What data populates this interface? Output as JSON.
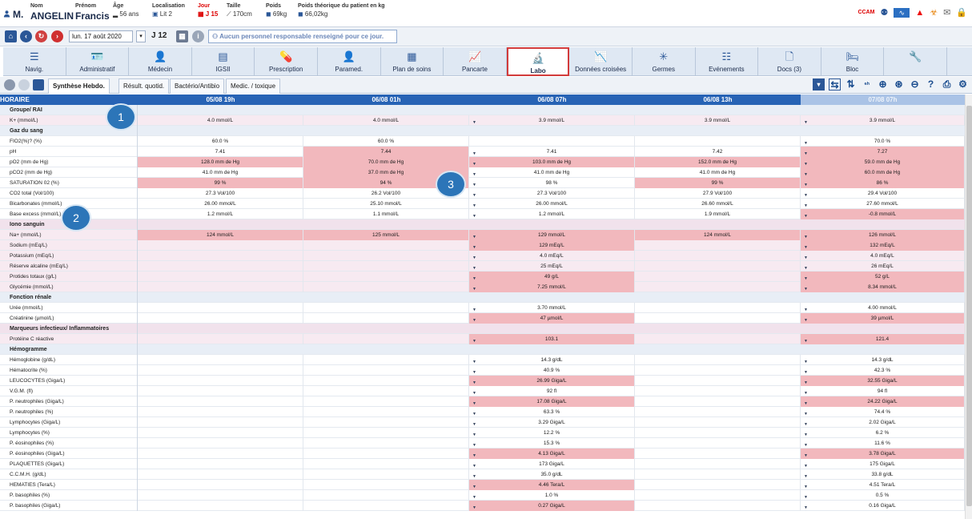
{
  "patient": {
    "nom_label": "Nom",
    "prenom_label": "Prénom",
    "age_label": "Âge",
    "loc_label": "Localisation",
    "jour_label": "Jour",
    "taille_label": "Taille",
    "poids_label": "Poids",
    "poids_theo_label": "Poids théorique du patient en kg",
    "civ": "M.",
    "nom": "ANGELIN",
    "prenom": "Francis",
    "age": "56 ans",
    "lit": "Lit 2",
    "jour": "J 15",
    "taille": "170cm",
    "poids": "69kg",
    "poids_theo": "66,02kg"
  },
  "header_icons": {
    "ccam": "CCAM"
  },
  "toolbar": {
    "date": "lun. 17 août 2020",
    "j": "J 12",
    "message": "Aucun personnel responsable renseigné pour ce jour."
  },
  "modules": [
    {
      "label": "Navig.",
      "icon": "navig-icon"
    },
    {
      "label": "Administratif",
      "icon": "admin-icon"
    },
    {
      "label": "Médecin",
      "icon": "doctor-icon"
    },
    {
      "label": "IGSII",
      "icon": "document-icon"
    },
    {
      "label": "Prescription",
      "icon": "pill-icon"
    },
    {
      "label": "Paramed.",
      "icon": "nurse-icon"
    },
    {
      "label": "Plan de soins",
      "icon": "grid-icon"
    },
    {
      "label": "Pancarte",
      "icon": "chart-icon"
    },
    {
      "label": "Labo",
      "icon": "microscope-icon"
    },
    {
      "label": "Données croisées",
      "icon": "chart2-icon"
    },
    {
      "label": "Germes",
      "icon": "germ-icon"
    },
    {
      "label": "Evénements",
      "icon": "list-icon"
    },
    {
      "label": "Docs (3)",
      "icon": "docs-icon"
    },
    {
      "label": "Bloc",
      "icon": "bed-icon"
    },
    {
      "label": "",
      "icon": "wrench-icon"
    }
  ],
  "tabs": [
    "Synthèse Hebdo.",
    "Résult. quotid.",
    "Bactério/Antibio",
    "Medic. / toxique"
  ],
  "grid": {
    "header": [
      "HORAIRE",
      "05/08 19h",
      "06/08 01h",
      "06/08 07h",
      "06/08 13h",
      "07/08 07h"
    ],
    "rows": [
      {
        "label": "Groupe/ RAI",
        "section": true
      },
      {
        "label": "K+ (mmol/L)",
        "lc": true,
        "v": [
          "4.0 mmol/L",
          "4.0 mmol/L",
          "3.9 mmol/L",
          "3.9 mmol/L",
          "3.9 mmol/L"
        ]
      },
      {
        "label": "Gaz du sang",
        "section": true
      },
      {
        "label": "FIO2(%)? (%)",
        "v": [
          "60.0 %",
          "60.0 %",
          "",
          "",
          "70.0 %"
        ]
      },
      {
        "label": "pH",
        "v": [
          "7.41",
          "7.44",
          "7.41",
          "7.42",
          "7.27"
        ],
        "ab": [
          false,
          true,
          false,
          false,
          true
        ]
      },
      {
        "label": "pO2 (mm de Hg)",
        "v": [
          "128.0 mm de Hg",
          "70.0 mm de Hg",
          "103.0 mm de Hg",
          "152.0 mm de Hg",
          "59.0 mm de Hg"
        ],
        "ab": [
          true,
          true,
          true,
          true,
          true
        ]
      },
      {
        "label": "pCO2 (mm de Hg)",
        "v": [
          "41.0 mm de Hg",
          "37.0 mm de Hg",
          "41.0 mm de Hg",
          "41.0 mm de Hg",
          "60.0 mm de Hg"
        ],
        "ab": [
          false,
          true,
          false,
          false,
          true
        ]
      },
      {
        "label": "SATURATION 02 (%)",
        "v": [
          "99 %",
          "94 %",
          "98 %",
          "99 %",
          "86 %"
        ],
        "ab": [
          true,
          true,
          false,
          true,
          true
        ]
      },
      {
        "label": "CO2 total (Vol/100)",
        "v": [
          "27.3 Vol/100",
          "26.2 Vol/100",
          "27.3 Vol/100",
          "27.9 Vol/100",
          "29.4 Vol/100"
        ]
      },
      {
        "label": "Bicarbonates (mmol/L)",
        "v": [
          "26.00 mmol/L",
          "25.10 mmol/L",
          "26.00 mmol/L",
          "26.60 mmol/L",
          "27.60 mmol/L"
        ]
      },
      {
        "label": "Base excess (mmol/L)",
        "v": [
          "1.2 mmol/L",
          "1.1 mmol/L",
          "1.2 mmol/L",
          "1.9 mmol/L",
          "-0.8 mmol/L"
        ],
        "ab": [
          false,
          false,
          false,
          false,
          true
        ]
      },
      {
        "label": "Iono sanguin",
        "section": true,
        "lc": true
      },
      {
        "label": "Na+ (mmol/L)",
        "lc": true,
        "v": [
          "124 mmol/L",
          "125 mmol/L",
          "129 mmol/L",
          "124 mmol/L",
          "126 mmol/L"
        ],
        "ab": [
          true,
          true,
          true,
          true,
          true
        ]
      },
      {
        "label": "Sodium (mEq/L)",
        "lc": true,
        "v": [
          "",
          "",
          "129 mEq/L",
          "",
          "132 mEq/L"
        ],
        "ab": [
          false,
          false,
          true,
          false,
          true
        ]
      },
      {
        "label": "Potassium (mEq/L)",
        "lc": true,
        "v": [
          "",
          "",
          "4.0 mEq/L",
          "",
          "4.0 mEq/L"
        ]
      },
      {
        "label": "Réserve alcaline (mEq/L)",
        "lc": true,
        "v": [
          "",
          "",
          "25 mEq/L",
          "",
          "26 mEq/L"
        ]
      },
      {
        "label": "Protides totaux (g/L)",
        "lc": true,
        "v": [
          "",
          "",
          "49 g/L",
          "",
          "52 g/L"
        ],
        "ab": [
          false,
          false,
          true,
          false,
          true
        ]
      },
      {
        "label": "Glycémie (mmol/L)",
        "lc": true,
        "v": [
          "",
          "",
          "7.25 mmol/L",
          "",
          "8.34 mmol/L"
        ],
        "ab": [
          false,
          false,
          true,
          false,
          true
        ]
      },
      {
        "label": "Fonction rénale",
        "section": true
      },
      {
        "label": "Urée (mmol/L)",
        "v": [
          "",
          "",
          "3.70 mmol/L",
          "",
          "4.00 mmol/L"
        ]
      },
      {
        "label": "Créatinine (µmol/L)",
        "v": [
          "",
          "",
          "47 µmol/L",
          "",
          "39 µmol/L"
        ],
        "ab": [
          false,
          false,
          true,
          false,
          true
        ]
      },
      {
        "label": "Marqueurs infectieux/ Inflammatoires",
        "section": true,
        "lc": true
      },
      {
        "label": "Protéine C réactive",
        "lc": true,
        "v": [
          "",
          "",
          "103.1",
          "",
          "121.4"
        ],
        "ab": [
          false,
          false,
          true,
          false,
          true
        ]
      },
      {
        "label": "Hémogramme",
        "section": true
      },
      {
        "label": "Hémoglobine (g/dL)",
        "v": [
          "",
          "",
          "14.3 g/dL",
          "",
          "14.3 g/dL"
        ]
      },
      {
        "label": "Hématocrite (%)",
        "v": [
          "",
          "",
          "40.9 %",
          "",
          "42.3 %"
        ]
      },
      {
        "label": "LEUCOCYTES (Giga/L)",
        "v": [
          "",
          "",
          "26.99 Giga/L",
          "",
          "32.55 Giga/L"
        ],
        "ab": [
          false,
          false,
          true,
          false,
          true
        ]
      },
      {
        "label": "V.G.M. (fl)",
        "v": [
          "",
          "",
          "92 fl",
          "",
          "94 fl"
        ]
      },
      {
        "label": "P. neutrophiles (Giga/L)",
        "v": [
          "",
          "",
          "17.08 Giga/L",
          "",
          "24.22 Giga/L"
        ],
        "ab": [
          false,
          false,
          true,
          false,
          true
        ]
      },
      {
        "label": "P. neutrophiles (%)",
        "v": [
          "",
          "",
          "63.3 %",
          "",
          "74.4 %"
        ]
      },
      {
        "label": "Lymphocytes (Giga/L)",
        "v": [
          "",
          "",
          "3.29 Giga/L",
          "",
          "2.02 Giga/L"
        ]
      },
      {
        "label": "Lymphocytes (%)",
        "v": [
          "",
          "",
          "12.2 %",
          "",
          "6.2 %"
        ]
      },
      {
        "label": "P. éosinophiles (%)",
        "v": [
          "",
          "",
          "15.3 %",
          "",
          "11.6 %"
        ]
      },
      {
        "label": "P. éosinophiles (Giga/L)",
        "v": [
          "",
          "",
          "4.13 Giga/L",
          "",
          "3.78 Giga/L"
        ],
        "ab": [
          false,
          false,
          true,
          false,
          true
        ]
      },
      {
        "label": "PLAQUETTES (Giga/L)",
        "v": [
          "",
          "",
          "173 Giga/L",
          "",
          "175 Giga/L"
        ]
      },
      {
        "label": "C.C.M.H. (g/dL)",
        "v": [
          "",
          "",
          "35.0 g/dL",
          "",
          "33.8 g/dL"
        ]
      },
      {
        "label": "HEMATIES (Tera/L)",
        "v": [
          "",
          "",
          "4.46 Tera/L",
          "",
          "4.51 Tera/L"
        ],
        "ab": [
          false,
          false,
          true,
          false,
          false
        ]
      },
      {
        "label": "P. basophiles (%)",
        "v": [
          "",
          "",
          "1.0 %",
          "",
          "0.5 %"
        ]
      },
      {
        "label": "P. basophiles (Giga/L)",
        "v": [
          "",
          "",
          "0.27 Giga/L",
          "",
          "0.16 Giga/L"
        ],
        "ab": [
          false,
          false,
          true,
          false,
          false
        ]
      }
    ]
  },
  "callouts": [
    "1",
    "2",
    "3"
  ]
}
